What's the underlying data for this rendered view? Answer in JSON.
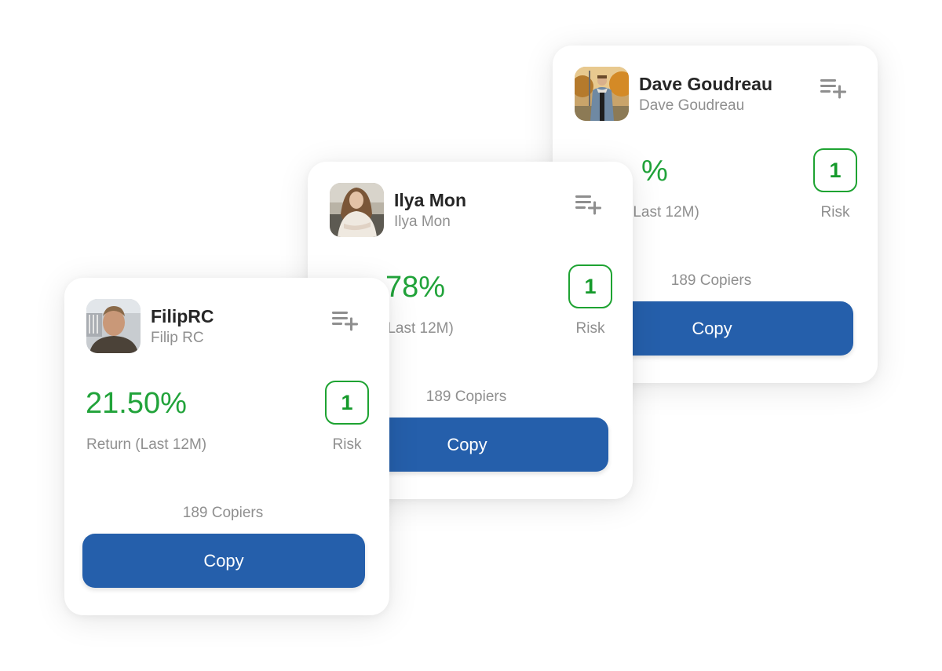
{
  "accent_colors": {
    "return_green": "#21a33a",
    "risk_border": "#1ea332",
    "copy_button_blue": "#255fab"
  },
  "traders": [
    {
      "name": "Dave Goudreau",
      "handle": "Dave Goudreau",
      "return_value": "%",
      "return_label": "(Last 12M)",
      "risk_score": "1",
      "risk_label": "Risk",
      "copiers": "189 Copiers",
      "copy_label": "Copy",
      "avatar_icon": "avatar-photo-man-denim-jacket-autumn",
      "watchlist_icon": "playlist-add-icon"
    },
    {
      "name": "Ilya Mon",
      "handle": "Ilya Mon",
      "return_value": "78%",
      "return_label": "(Last 12M)",
      "risk_score": "1",
      "risk_label": "Risk",
      "copiers": "189 Copiers",
      "copy_label": "Copy",
      "avatar_icon": "avatar-photo-woman-white-blouse",
      "watchlist_icon": "playlist-add-icon"
    },
    {
      "name": "FilipRC",
      "handle": "Filip RC",
      "return_value": "21.50%",
      "return_label": "Return (Last 12M)",
      "risk_score": "1",
      "risk_label": "Risk",
      "copiers": "189 Copiers",
      "copy_label": "Copy",
      "avatar_icon": "avatar-photo-man-selfie",
      "watchlist_icon": "playlist-add-icon"
    }
  ]
}
